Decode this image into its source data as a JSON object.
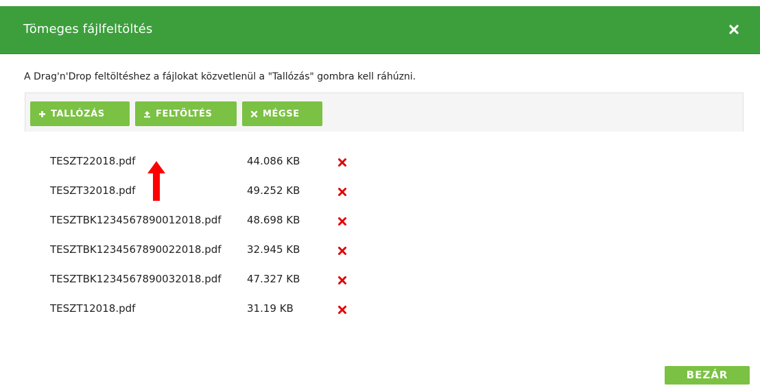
{
  "dialog": {
    "title": "Tömeges fájlfeltöltés",
    "hint": "A Drag'n'Drop feltöltéshez a fájlokat közvetlenül a \"Tallózás\" gombra kell ráhúzni."
  },
  "toolbar": {
    "browse_label": "TALLÓZÁS",
    "upload_label": "FELTÖLTÉS",
    "cancel_label": "MÉGSE"
  },
  "files": [
    {
      "name": "TESZT22018.pdf",
      "size": "44.086 KB"
    },
    {
      "name": "TESZT32018.pdf",
      "size": "49.252 KB"
    },
    {
      "name": "TESZTBK1234567890012018.pdf",
      "size": "48.698 KB"
    },
    {
      "name": "TESZTBK1234567890022018.pdf",
      "size": "32.945 KB"
    },
    {
      "name": "TESZTBK1234567890032018.pdf",
      "size": "47.327 KB"
    },
    {
      "name": "TESZT12018.pdf",
      "size": "31.19 KB"
    }
  ],
  "footer": {
    "close_label": "BEZÁR"
  },
  "colors": {
    "header": "#3c9f3c",
    "button": "#7bc143",
    "remove": "#e00000",
    "arrow": "#ff0000"
  }
}
